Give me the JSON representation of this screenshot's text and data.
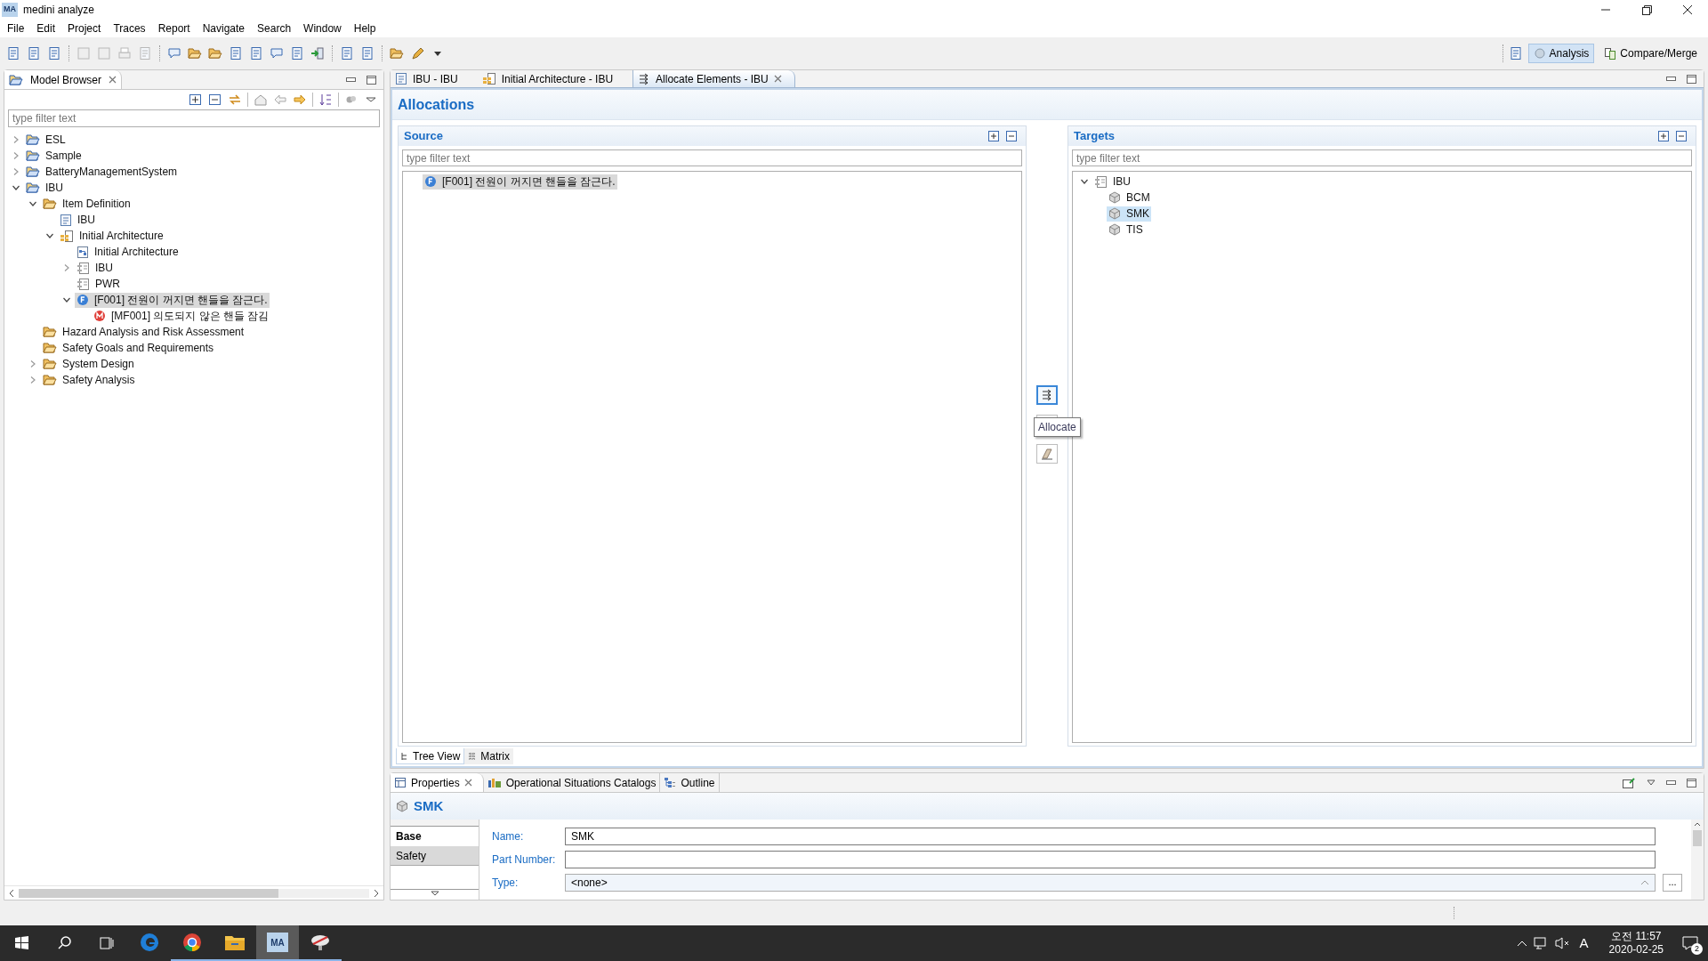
{
  "window": {
    "icon_label": "MA",
    "title": "medini analyze"
  },
  "menu": [
    "File",
    "Edit",
    "Project",
    "Traces",
    "Report",
    "Navigate",
    "Search",
    "Window",
    "Help"
  ],
  "perspectives": [
    {
      "label": "Analysis",
      "selected": true
    },
    {
      "label": "Compare/Merge",
      "selected": false
    }
  ],
  "model_browser": {
    "title": "Model Browser",
    "filter_placeholder": "type filter text",
    "tree": [
      {
        "label": "ESL",
        "kind": "project",
        "expanded": false,
        "selected": false
      },
      {
        "label": "Sample",
        "kind": "project",
        "expanded": false,
        "selected": false
      },
      {
        "label": "BatteryManagementSystem",
        "kind": "project",
        "expanded": false,
        "selected": false
      },
      {
        "label": "IBU",
        "kind": "project",
        "expanded": true,
        "selected": false,
        "children": [
          {
            "label": "Item Definition",
            "kind": "folder",
            "expanded": true,
            "selected": false,
            "children": [
              {
                "label": "IBU",
                "kind": "document",
                "selected": false
              },
              {
                "label": "Initial Architecture",
                "kind": "architecture",
                "expanded": true,
                "selected": false,
                "children": [
                  {
                    "label": "Initial Architecture",
                    "kind": "diagram",
                    "selected": false
                  },
                  {
                    "label": "IBU",
                    "kind": "component",
                    "expanded": false,
                    "selected": false
                  },
                  {
                    "label": "PWR",
                    "kind": "component",
                    "selected": false
                  },
                  {
                    "label": "[F001] 전원이 꺼지면 핸들을 잠근다.",
                    "kind": "function",
                    "expanded": true,
                    "selected": true,
                    "children": [
                      {
                        "label": "[MF001] 의도되지 않은 핸들 잠김",
                        "kind": "malfunction",
                        "selected": false
                      }
                    ]
                  }
                ]
              }
            ]
          },
          {
            "label": "Hazard Analysis and Risk Assessment",
            "kind": "folder",
            "selected": false
          },
          {
            "label": "Safety Goals and Requirements",
            "kind": "folder",
            "selected": false
          },
          {
            "label": "System Design",
            "kind": "folder",
            "expanded": false,
            "selected": false
          },
          {
            "label": "Safety Analysis",
            "kind": "folder",
            "expanded": false,
            "selected": false
          }
        ]
      }
    ]
  },
  "editor_tabs": [
    {
      "label": "IBU - IBU",
      "kind": "document",
      "selected": false
    },
    {
      "label": "Initial Architecture - IBU",
      "kind": "architecture",
      "selected": false
    },
    {
      "label": "Allocate Elements - IBU",
      "kind": "allocate",
      "selected": true
    }
  ],
  "allocations": {
    "title": "Allocations",
    "source": {
      "title": "Source",
      "filter_placeholder": "type filter text",
      "tree": [
        {
          "label": "[F001] 전원이 꺼지면 핸들을 잠근다.",
          "kind": "function",
          "selected": true
        }
      ]
    },
    "targets": {
      "title": "Targets",
      "filter_placeholder": "type filter text",
      "tree": [
        {
          "label": "IBU",
          "kind": "component",
          "expanded": true,
          "selected": false,
          "children": [
            {
              "label": "BCM",
              "kind": "block",
              "selected": false
            },
            {
              "label": "SMK",
              "kind": "block",
              "selected": true
            },
            {
              "label": "TIS",
              "kind": "block",
              "selected": false
            }
          ]
        }
      ]
    },
    "tooltip": "Allocate",
    "view_tabs": [
      {
        "label": "Tree View",
        "selected": true
      },
      {
        "label": "Matrix",
        "selected": false
      }
    ]
  },
  "bottom_tabs": [
    {
      "label": "Properties",
      "kind": "properties",
      "selected": true
    },
    {
      "label": "Operational Situations Catalogs",
      "kind": "catalog",
      "selected": false
    },
    {
      "label": "Outline",
      "kind": "outline",
      "selected": false
    }
  ],
  "properties": {
    "title": "SMK",
    "sections": [
      {
        "label": "Base",
        "selected": true
      },
      {
        "label": "Safety",
        "selected": false
      }
    ],
    "fields": [
      {
        "label": "Name:",
        "kind": "text",
        "value": "SMK"
      },
      {
        "label": "Part Number:",
        "kind": "text"
      },
      {
        "label": "Type:",
        "kind": "combo",
        "value": "<none>",
        "button": "..."
      }
    ]
  },
  "taskbar": {
    "apps": [
      {
        "kind": "edge",
        "running": false,
        "selected": false
      },
      {
        "kind": "chrome",
        "running": true,
        "selected": false
      },
      {
        "kind": "explorer",
        "running": true,
        "selected": false
      },
      {
        "kind": "medini",
        "label": "MA",
        "running": true,
        "selected": true
      },
      {
        "kind": "satellite",
        "running": true,
        "selected": false
      }
    ],
    "input_mode": "A",
    "time": "오전 11:57",
    "date": "2020-02-25",
    "notifications": "2"
  }
}
